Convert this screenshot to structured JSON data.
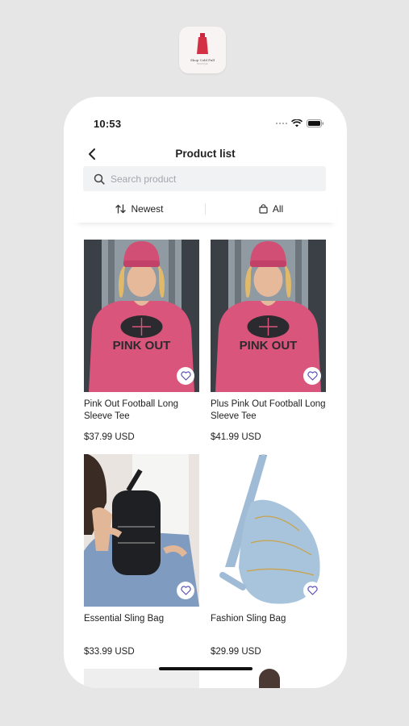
{
  "app_icon": {
    "brand": "Shop Cold Pull",
    "sub": "BOUTIQUE"
  },
  "status": {
    "time": "10:53"
  },
  "nav": {
    "title": "Product list",
    "back_icon": "chevron-left-icon"
  },
  "search": {
    "placeholder": "Search product",
    "value": ""
  },
  "filters": {
    "sort_label": "Newest",
    "sort_icon": "sort-arrows-icon",
    "category_label": "All",
    "category_icon": "bag-icon"
  },
  "products": [
    {
      "name": "Pink Out Football Long Sleeve Tee",
      "price": "$37.99 USD",
      "image": "pink-out-sweatshirt",
      "shirt_text": "PINK OUT"
    },
    {
      "name": "Plus Pink Out Football Long Sleeve Tee",
      "price": "$41.99 USD",
      "image": "pink-out-sweatshirt",
      "shirt_text": "PINK OUT"
    },
    {
      "name": "Essential Sling Bag",
      "price": "$33.99 USD",
      "image": "black-sling-bag"
    },
    {
      "name": "Fashion Sling Bag",
      "price": "$29.99 USD",
      "image": "blue-sling-bag"
    }
  ],
  "colors": {
    "accent": "#5b4fb8",
    "background": "#e6e6e6",
    "shirt_pink": "#d9557b",
    "search_bg": "#f1f2f4"
  }
}
